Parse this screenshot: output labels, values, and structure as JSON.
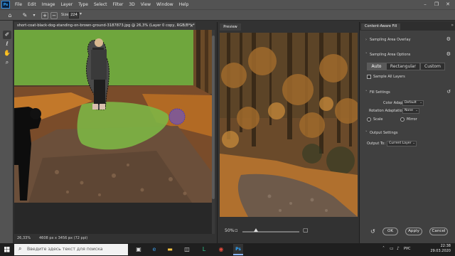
{
  "menubar": {
    "logo": "Ps",
    "items": [
      "File",
      "Edit",
      "Image",
      "Layer",
      "Type",
      "Select",
      "Filter",
      "3D",
      "View",
      "Window",
      "Help"
    ]
  },
  "options": {
    "size_label": "Size:",
    "size_value": "224"
  },
  "document": {
    "tab_title": "short-coat-black-dog-standing-on-brown-ground-3187873.jpg @ 26,3% (Layer 0 copy, RGB/8*) *",
    "zoom": "26,33%",
    "dimensions": "4608 px x 3456 px (72 ppi)"
  },
  "preview": {
    "tab": "Preview",
    "zoom": "50%"
  },
  "caf": {
    "title": "Content-Aware Fill",
    "sampling_overlay": "Sampling Area Overlay",
    "sampling_options": "Sampling Area Options",
    "sampling_modes": [
      "Auto",
      "Rectangular",
      "Custom"
    ],
    "sample_all_layers": "Sample All Layers",
    "fill_settings": "Fill Settings",
    "color_adaptation_label": "Color Adaptation:",
    "color_adaptation_value": "Default",
    "rotation_adaptation_label": "Rotation Adaptation:",
    "rotation_adaptation_value": "None",
    "scale_label": "Scale",
    "mirror_label": "Mirror",
    "output_settings": "Output Settings",
    "output_to_label": "Output To:",
    "output_to_value": "Current Layer",
    "ok": "OK",
    "apply": "Apply",
    "cancel": "Cancel"
  },
  "taskbar": {
    "search_placeholder": "Введите здесь текст для поиска",
    "lang": "РУС",
    "time": "22:38",
    "date": "29.03.2020"
  }
}
